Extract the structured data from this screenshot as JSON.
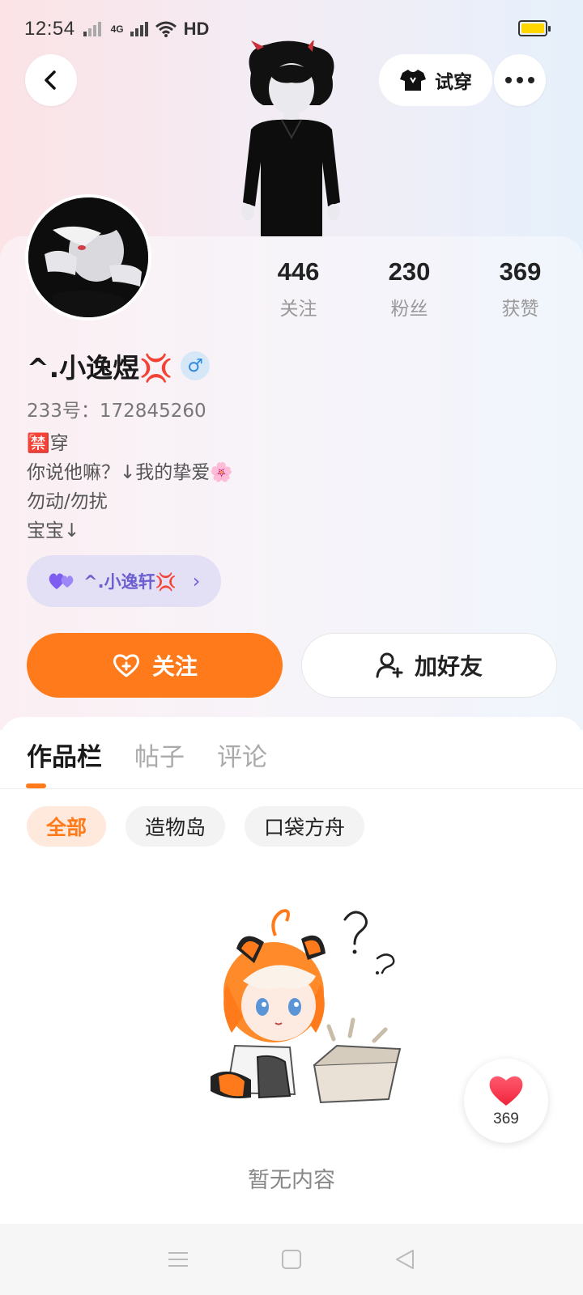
{
  "status_bar": {
    "time": "12:54",
    "network": "4G",
    "hd_label": "HD",
    "battery_color": "#ffd600"
  },
  "header": {
    "back_icon": "chevron-left-icon",
    "try_on_label": "试穿",
    "try_on_icon": "tshirt-icon",
    "more_icon": "more-dots-icon"
  },
  "profile": {
    "stats": [
      {
        "value": "446",
        "label": "关注"
      },
      {
        "value": "230",
        "label": "粉丝"
      },
      {
        "value": "369",
        "label": "获赞"
      }
    ],
    "name": "^.小逸煜💢",
    "gender_symbol": "♂",
    "gender_color": "#2f8ae0",
    "uid": "233号：172845260",
    "bio_lines": [
      "🈲穿",
      "你说他嘛？↓我的挚爱🌸",
      "勿动/勿扰",
      "宝宝↓"
    ],
    "cp_link": {
      "label": "^.小逸轩💢",
      "icon": "hearts-icon",
      "chevron": "›"
    }
  },
  "actions": {
    "follow_label": "关注",
    "add_friend_label": "加好友",
    "accent_color": "#ff7a1a"
  },
  "content": {
    "tabs": [
      {
        "label": "作品栏",
        "active": true
      },
      {
        "label": "帖子",
        "active": false
      },
      {
        "label": "评论",
        "active": false
      }
    ],
    "filters": [
      {
        "label": "全部",
        "active": true
      },
      {
        "label": "造物岛",
        "active": false
      },
      {
        "label": "口袋方舟",
        "active": false
      }
    ],
    "empty_text": "暂无内容"
  },
  "like_fab": {
    "count": "369",
    "icon": "heart-icon"
  },
  "nav_bar": {
    "items": [
      "menu-icon",
      "home-square-icon",
      "back-triangle-icon"
    ]
  }
}
